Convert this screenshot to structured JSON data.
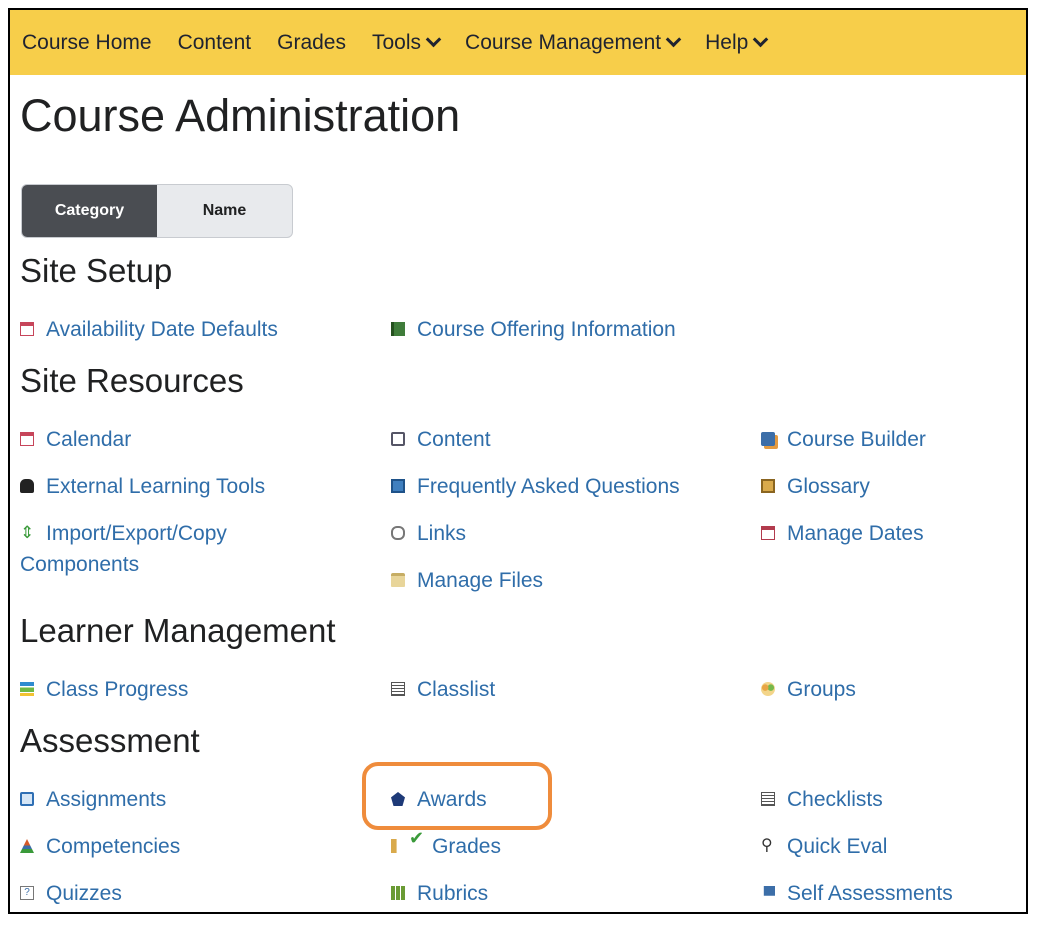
{
  "topnav": {
    "items": [
      {
        "label": "Course Home",
        "dropdown": false
      },
      {
        "label": "Content",
        "dropdown": false
      },
      {
        "label": "Grades",
        "dropdown": false
      },
      {
        "label": "Tools",
        "dropdown": true
      },
      {
        "label": "Course Management",
        "dropdown": true
      },
      {
        "label": "Help",
        "dropdown": true
      }
    ]
  },
  "page_title": "Course Administration",
  "view_toggle": {
    "category": "Category",
    "name": "Name",
    "active": "Category"
  },
  "sections": {
    "site_setup": {
      "title": "Site Setup",
      "links": [
        "Availability Date Defaults",
        "Course Offering Information"
      ]
    },
    "site_resources": {
      "title": "Site Resources",
      "links": [
        "Calendar",
        "Content",
        "Course Builder",
        "External Learning Tools",
        "Frequently Asked Questions",
        "Glossary",
        "Import/Export/Copy Components",
        "Links",
        "Manage Dates",
        "Manage Files"
      ]
    },
    "learner_management": {
      "title": "Learner Management",
      "links": [
        "Class Progress",
        "Classlist",
        "Groups"
      ]
    },
    "assessment": {
      "title": "Assessment",
      "links": [
        "Assignments",
        "Awards",
        "Checklists",
        "Competencies",
        "Grades",
        "Quick Eval",
        "Quizzes",
        "Rubrics",
        "Self Assessments"
      ]
    }
  },
  "colors": {
    "nav_bg": "#f7ce4a",
    "link": "#2f6da9",
    "highlight": "#ef8c3c",
    "toggle_active": "#4a4d52"
  }
}
